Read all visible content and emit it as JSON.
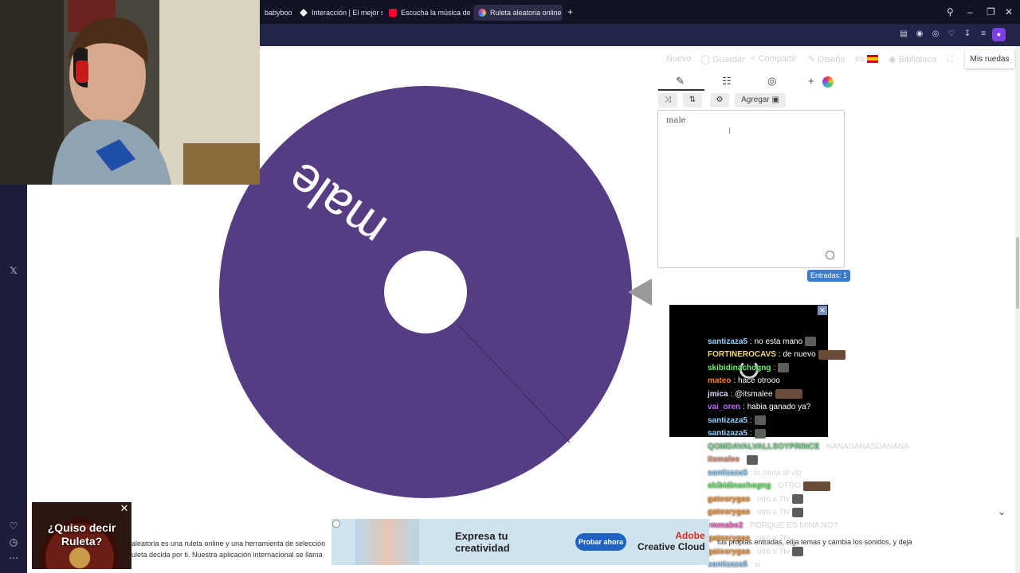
{
  "browser": {
    "tabs": [
      {
        "label": "babyboo |",
        "icon_color": "#ffffff"
      },
      {
        "label": "Interacción | El mejor softw",
        "icon_color": "#ffffff"
      },
      {
        "label": "Escucha la música de mat",
        "icon_color": "#ff0033"
      },
      {
        "label": "Ruleta aleatoria online – ",
        "icon_color": "#e8508a",
        "active": true
      }
    ],
    "new_tab": "+"
  },
  "wheel": {
    "entry_text": "male",
    "color": "#563d83"
  },
  "menu": {
    "nuevo": "Nuevo",
    "guardar": "Guardar",
    "compartir": "Compartir",
    "diseno": "Diseño",
    "language": "es",
    "biblioteca": "Biblioteca",
    "mis_ruedas": "Mis ruedas"
  },
  "editor": {
    "textarea_value": "male",
    "add_button": "Agregar",
    "entries_label": "Entradas: 1"
  },
  "chat": [
    {
      "user": "santizaza5",
      "color": "#8fd1ff",
      "msg": ": no esta mano",
      "emote": true
    },
    {
      "user": "FORTINEROCAVS",
      "color": "#f5d76e",
      "msg": ": de nuevo",
      "emote": "wide"
    },
    {
      "user": "skibidinachogng",
      "color": "#6df06d",
      "msg": ":",
      "emote": true
    },
    {
      "user": "mateo",
      "color": "#ff7d1a",
      "msg": ": hace otrooo"
    },
    {
      "user": "jmica",
      "color": "#dcdcff",
      "msg": ": @itsmalee",
      "emote": "wide"
    },
    {
      "user": "vai_oren",
      "color": "#c46cff",
      "msg": ": habia ganado ya?"
    },
    {
      "user": "santizaza5",
      "color": "#8fd1ff",
      "msg": ":",
      "emote": true
    },
    {
      "user": "santizaza5",
      "color": "#8fd1ff",
      "msg": ":",
      "emote": true
    },
    {
      "user": "QOMDAVALVALLSOYPRINCE",
      "color": "#7cd992",
      "msg": ": NANANANASDANANA",
      "faded": true
    },
    {
      "user": "itsmalee",
      "color": "#e89b7a",
      "msg": ":",
      "emote": true,
      "faded": true
    },
    {
      "user": "santizaza5",
      "color": "#8fd1ff",
      "msg": ": lo haria al vip",
      "faded": true
    },
    {
      "user": "skibidinachogng",
      "color": "#6df06d",
      "msg": ": OTRO",
      "emote": "wide",
      "faded": true
    },
    {
      "user": "gatosrygas",
      "color": "#ff9a3c",
      "msg": ": otro x 7tv",
      "emote": true,
      "faded": true
    },
    {
      "user": "gatosrygas",
      "color": "#ff9a3c",
      "msg": ": otro x 7tv",
      "emote": true,
      "faded": true
    },
    {
      "user": "rmmabe2",
      "color": "#ff66cc",
      "msg": ": PORQUE ES MINA NO?",
      "faded": true
    },
    {
      "user": "gatosrygas",
      "color": "#ff9a3c",
      "msg": ": otro x 7tv",
      "faded": true
    },
    {
      "user": "gatosrygas",
      "color": "#ff9a3c",
      "msg": ": otro x 7tv",
      "emote": true,
      "faded": true
    },
    {
      "user": "santizaza5",
      "color": "#8fd1ff",
      "msg": ": si",
      "faded": true
    }
  ],
  "bottom": {
    "line1": "aleatoria es una ruleta online y una herramienta de selección",
    "line2": "uleta decida por ti. Nuestra aplicación internacional se llama",
    "right_text": "tus propias entradas, elija temas y cambia los sonidos, y deja"
  },
  "ad": {
    "headline": "Expresa tu creatividad",
    "cta": "Probar ahora",
    "brand_line1": "Adobe",
    "brand_line2": "Creative Cloud"
  },
  "promo": {
    "text": "¿Quiso decir Ruleta?",
    "close": "✕"
  }
}
